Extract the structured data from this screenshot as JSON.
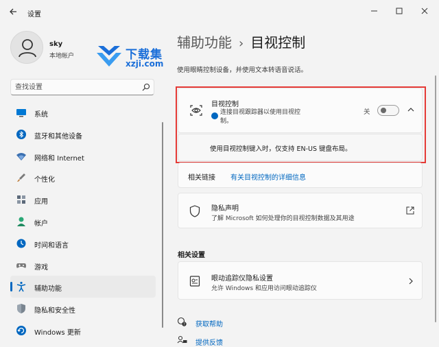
{
  "window": {
    "title": "设置",
    "controls": {
      "minimize": "minimize-icon",
      "maximize": "maximize-icon",
      "close": "close-icon"
    }
  },
  "profile": {
    "name": "sky",
    "account_type": "本地帐户"
  },
  "watermark": {
    "line1": "下载集",
    "line2": "xzji.com"
  },
  "search": {
    "placeholder": "查找设置",
    "value": ""
  },
  "sidebar": {
    "items": [
      {
        "label": "系统",
        "icon": "monitor-icon",
        "color": "#0078d4"
      },
      {
        "label": "蓝牙和其他设备",
        "icon": "bluetooth-icon",
        "color": "#0067c0"
      },
      {
        "label": "网络和 Internet",
        "icon": "wifi-icon",
        "color": "#3a6fb0"
      },
      {
        "label": "个性化",
        "icon": "brush-icon",
        "color": "#c08040"
      },
      {
        "label": "应用",
        "icon": "apps-icon",
        "color": "#5c6a7a"
      },
      {
        "label": "帐户",
        "icon": "account-icon",
        "color": "#2aa876"
      },
      {
        "label": "时间和语言",
        "icon": "globe-clock-icon",
        "color": "#0067c0"
      },
      {
        "label": "游戏",
        "icon": "gamepad-icon",
        "color": "#7a7a7a"
      },
      {
        "label": "辅助功能",
        "icon": "accessibility-icon",
        "color": "#0067c0",
        "active": true
      },
      {
        "label": "隐私和安全性",
        "icon": "shield-icon",
        "color": "#7a8590"
      },
      {
        "label": "Windows 更新",
        "icon": "update-icon",
        "color": "#0067c0"
      }
    ]
  },
  "main": {
    "breadcrumb_parent": "辅助功能",
    "breadcrumb_current": "目视控制",
    "description": "使用眼睛控制设备，并使用文本转语音说话。",
    "eye_control": {
      "title": "目视控制",
      "description": "连接目视跟踪器以使用目视控制。",
      "toggle_label": "关",
      "toggle_on": false,
      "expanded_text": "使用目视控制键入时，仅支持 EN-US 键盘布局。"
    },
    "related_links": {
      "label": "相关链接",
      "link": "有关目视控制的详细信息"
    },
    "privacy": {
      "title": "隐私声明",
      "description": "了解 Microsoft 如何处理你的目视控制数据及其用途"
    },
    "related_settings_title": "相关设置",
    "tracker": {
      "title": "眼动追踪仪隐私设置",
      "description": "允许 Windows 和应用访问眼动追踪仪"
    },
    "help": "获取帮助",
    "feedback": "提供反馈"
  },
  "colors": {
    "accent": "#0067c0",
    "highlight_frame": "#e53935",
    "background": "#f3f3f3",
    "card": "#fbfbfb"
  }
}
